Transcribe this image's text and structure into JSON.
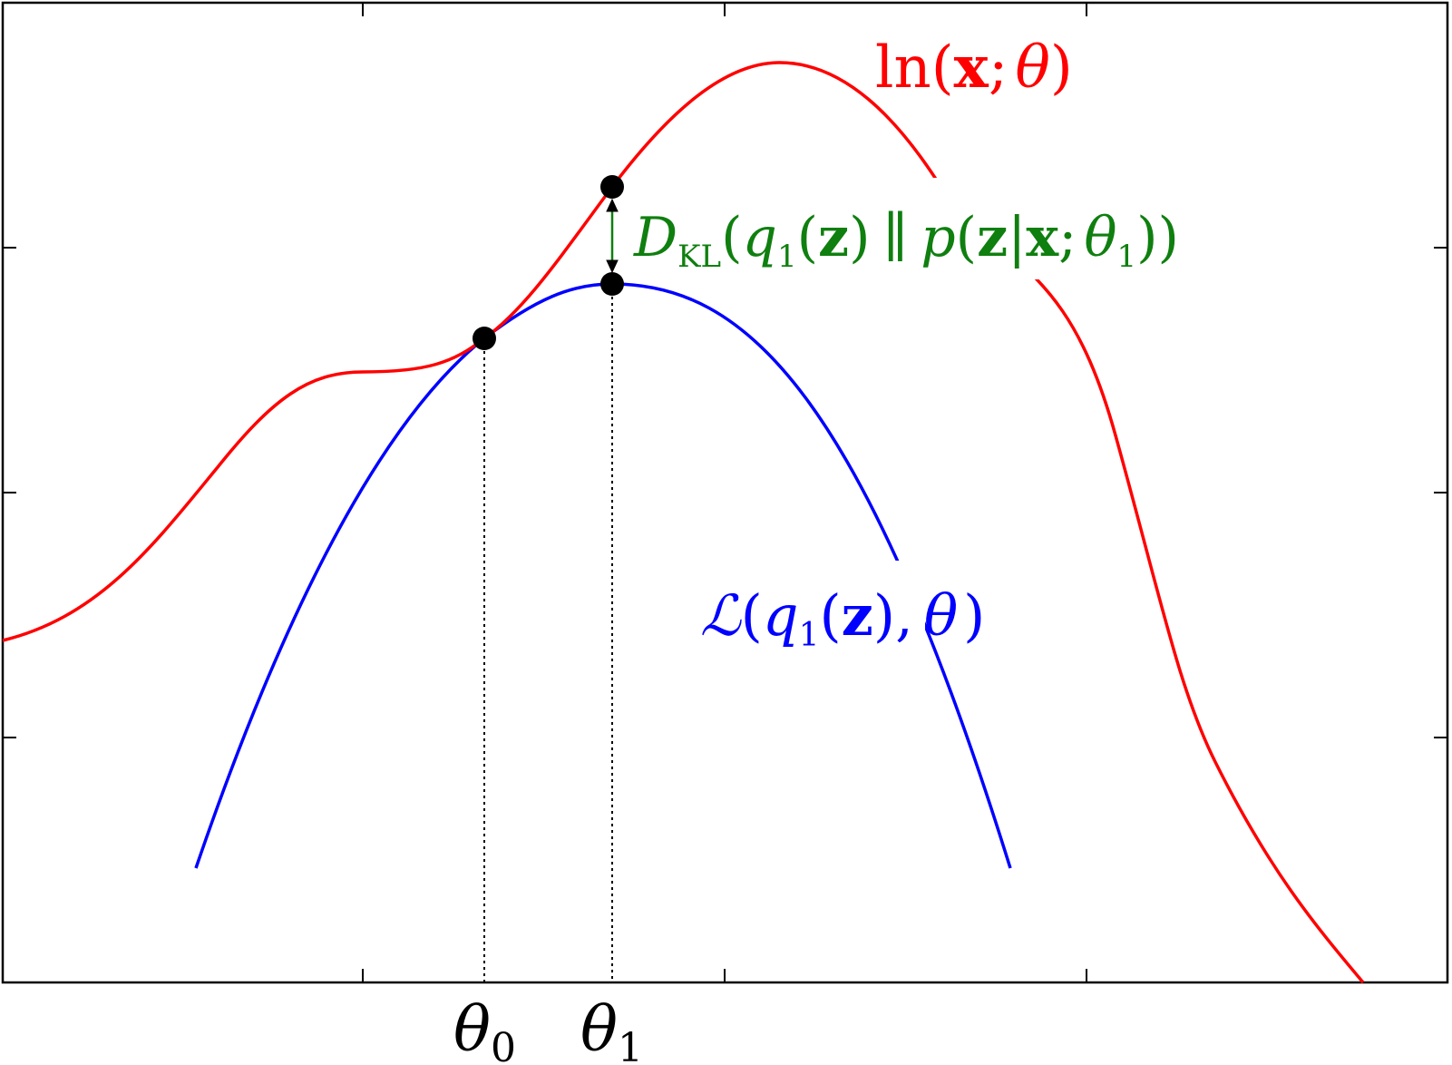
{
  "colors": {
    "frame": "#000000",
    "log_likelihood": "#ff0000",
    "lower_bound": "#0000ff",
    "kl_gap": "#0f7f0f",
    "points": "#000000",
    "guides": "#000000"
  },
  "labels": {
    "log_likelihood": {
      "ln": "ln",
      "open": "(",
      "x": "x",
      "semicolon": ";",
      "theta": "θ",
      "close": ")"
    },
    "lower_bound": {
      "L": "ℒ",
      "open": "(",
      "q": "q",
      "sub": "1",
      "open2": "(",
      "z": "z",
      "close2": ")",
      "comma": ",",
      "theta": "θ",
      "close": ")"
    },
    "kl": {
      "D": "D",
      "sub": "KL",
      "open": "(",
      "q": "q",
      "qsub": "1",
      "open2": "(",
      "z": "z",
      "close2": ")",
      "parallel": "∥",
      "p": "p",
      "open3": "(",
      "z2": "z",
      "bar": "|",
      "x": "x",
      "semicolon": ";",
      "theta": "θ",
      "thetasub": "1",
      "close3": ")",
      "close": ")"
    },
    "theta0": {
      "symbol": "θ",
      "sub": "0"
    },
    "theta1": {
      "symbol": "θ",
      "sub": "1"
    }
  }
}
